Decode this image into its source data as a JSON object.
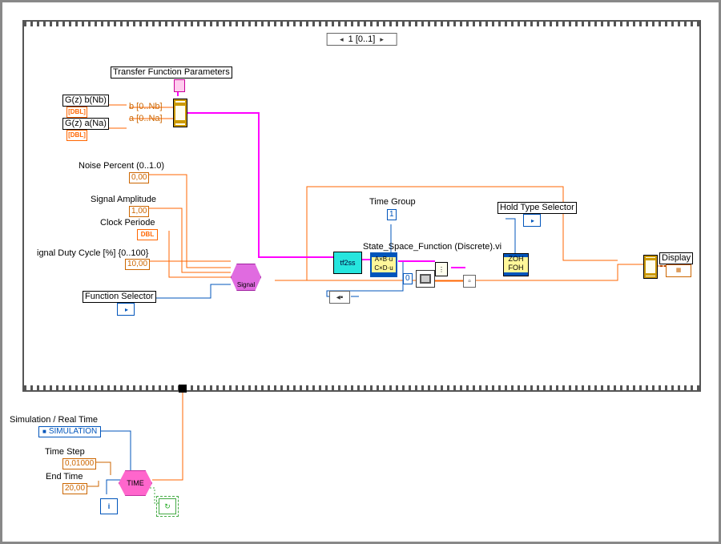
{
  "loop": {
    "case_label": "1 [0..1]"
  },
  "tf": {
    "section_title": "Transfer Function Parameters",
    "b_label": "G(z)  b(Nb)",
    "a_label": "G(z)  a(Na)",
    "dbl": "[DBL]",
    "b_range": "b [0..Nb]",
    "a_range": "a [0..Na]"
  },
  "inputs": {
    "noise_label": "Noise Percent (0..1.0)",
    "noise_value": "0,00",
    "amp_label": "Signal Amplitude",
    "amp_value": "1,00",
    "clk_label": "Clock Periode",
    "clk_badge": "DBL",
    "duty_label": "ignal Duty Cycle [%] {0..100}",
    "duty_value": "10,00",
    "fsel_label": "Function Selector"
  },
  "mid": {
    "signal_text": "Signal",
    "tf2ss": "tf2ss",
    "ss_label": "State_Space_Function (Discrete).vi",
    "ss_text_top": "A×B·u",
    "ss_text_bot": "C×D·u",
    "zero": "0",
    "tgroup_label": "Time Group",
    "tgroup_value": "1",
    "hold_label": "Hold Type Selector",
    "zoh": "ZOH",
    "foh": "FOH",
    "display_label": "Display"
  },
  "bottom": {
    "sim_label": "Simulation / Real Time",
    "sim_value": "SIMULATION",
    "step_label": "Time Step",
    "step_value": "0,01000",
    "end_label": "End Time",
    "end_value": "20,00",
    "time_text": "TIME",
    "i": "i"
  }
}
